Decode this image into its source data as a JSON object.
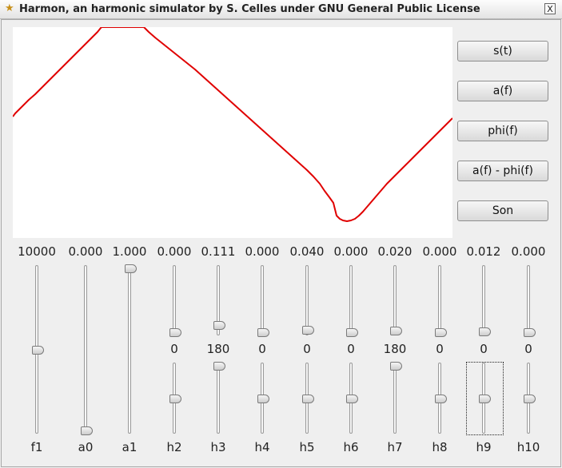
{
  "window": {
    "title": "Harmon, an harmonic simulator by S. Celles under GNU General Public License",
    "title_icon": "star-icon",
    "close_label": "X"
  },
  "plot": {
    "line_color": "#e00000"
  },
  "buttons": [
    "s(t)",
    "a(f)",
    "phi(f)",
    "a(f) - phi(f)",
    "Son"
  ],
  "sliders": [
    {
      "name": "f1",
      "value": "10000",
      "amp_level": 0.5
    },
    {
      "name": "a0",
      "value": "0.000",
      "amp_level": 0.0
    },
    {
      "name": "a1",
      "value": "1.000",
      "amp_level": 1.0
    },
    {
      "name": "h2",
      "value": "0.000",
      "amp_level": 0.0,
      "phase": "0",
      "phase_level": 0.5
    },
    {
      "name": "h3",
      "value": "0.111",
      "amp_level": 0.111,
      "phase": "180",
      "phase_level": 1.0
    },
    {
      "name": "h4",
      "value": "0.000",
      "amp_level": 0.0,
      "phase": "0",
      "phase_level": 0.5
    },
    {
      "name": "h5",
      "value": "0.040",
      "amp_level": 0.04,
      "phase": "0",
      "phase_level": 0.5
    },
    {
      "name": "h6",
      "value": "0.000",
      "amp_level": 0.0,
      "phase": "0",
      "phase_level": 0.5
    },
    {
      "name": "h7",
      "value": "0.020",
      "amp_level": 0.02,
      "phase": "180",
      "phase_level": 1.0
    },
    {
      "name": "h8",
      "value": "0.000",
      "amp_level": 0.0,
      "phase": "0",
      "phase_level": 0.5
    },
    {
      "name": "h9",
      "value": "0.012",
      "amp_level": 0.012,
      "phase": "0",
      "phase_level": 0.5
    },
    {
      "name": "h10",
      "value": "0.000",
      "amp_level": 0.0,
      "phase": "0",
      "phase_level": 0.5
    }
  ]
}
